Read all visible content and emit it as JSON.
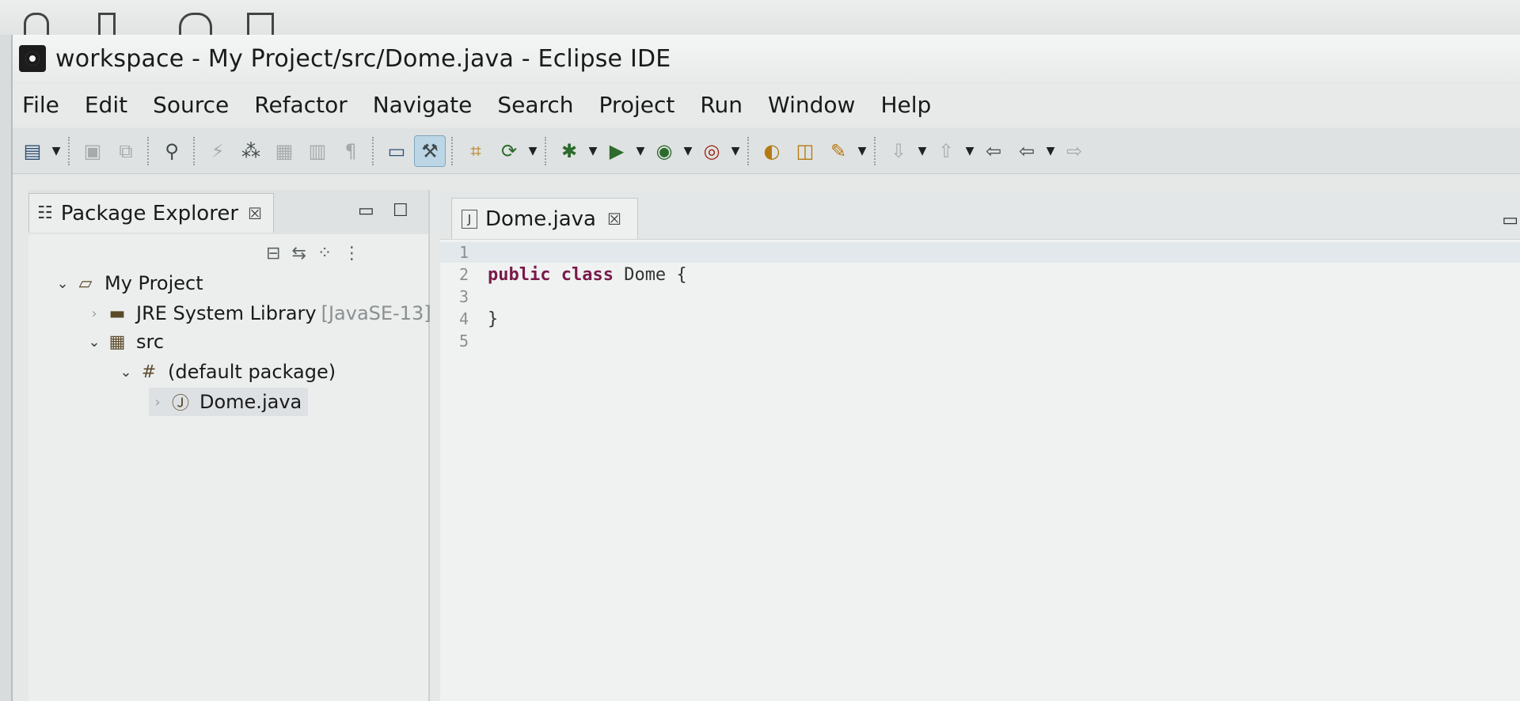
{
  "window": {
    "title": "workspace - My  Project/src/Dome.java - Eclipse IDE"
  },
  "menu": [
    "File",
    "Edit",
    "Source",
    "Refactor",
    "Navigate",
    "Search",
    "Project",
    "Run",
    "Window",
    "Help"
  ],
  "toolbar": {
    "icons": [
      "new-icon",
      "save-icon",
      "save-all-icon",
      "build-icon",
      "debug-icon",
      "run-icon",
      "search-icon",
      "open-type-icon",
      "next-annotation-icon",
      "back-icon",
      "forward-icon"
    ]
  },
  "package_explorer": {
    "title": "Package Explorer",
    "tree": [
      {
        "label": "My  Project",
        "decoration": "",
        "expanded": true
      },
      {
        "label": "JRE System Library",
        "decoration": "[JavaSE-13]",
        "expanded": false
      },
      {
        "label": "src",
        "decoration": "",
        "expanded": true
      },
      {
        "label": "(default package)",
        "decoration": "",
        "expanded": true
      },
      {
        "label": "Dome.java",
        "decoration": "",
        "expanded": false,
        "selected": true
      }
    ]
  },
  "editor": {
    "tab_label": "Dome.java",
    "lines": [
      {
        "num": "1",
        "keyword": "",
        "text": ""
      },
      {
        "num": "2",
        "keyword": "public class",
        "text": " Dome {"
      },
      {
        "num": "3",
        "keyword": "",
        "text": ""
      },
      {
        "num": "4",
        "keyword": "",
        "text": "}"
      },
      {
        "num": "5",
        "keyword": "",
        "text": ""
      }
    ]
  }
}
